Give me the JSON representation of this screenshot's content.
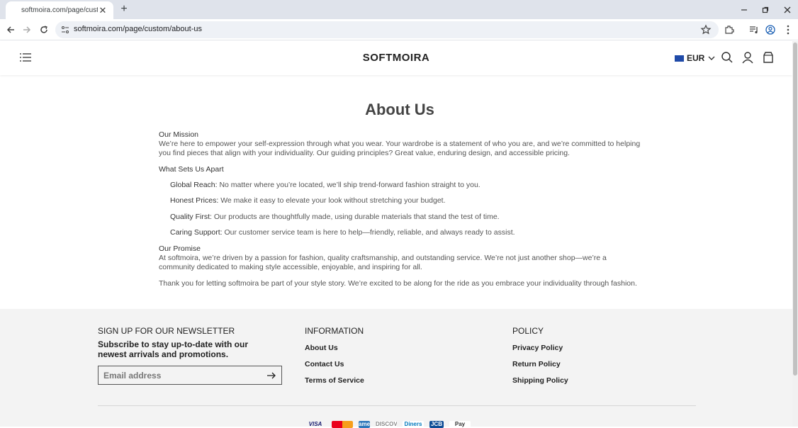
{
  "browser": {
    "tab_title": "softmoira.com/page/custom/about-us",
    "url": "softmoira.com/page/custom/about-us"
  },
  "site": {
    "logo": "SOFTMOIRA",
    "currency": "EUR"
  },
  "page": {
    "title": "About Us",
    "mission_heading": "Our Mission",
    "mission_text": "We’re here to empower your self-expression through what you wear. Your wardrobe is a statement of who you are, and we’re committed to helping you find pieces that align with your individuality. Our guiding principles? Great value, enduring design, and accessible pricing.",
    "apart_heading": "What Sets Us Apart",
    "items": [
      {
        "label": "Global Reach:",
        "text": " No matter where you’re located, we’ll ship trend-forward fashion straight to you."
      },
      {
        "label": "Honest Prices:",
        "text": " We make it easy to elevate your look without stretching your budget."
      },
      {
        "label": "Quality First:",
        "text": " Our products are thoughtfully made, using durable materials that stand the test of time."
      },
      {
        "label": "Caring Support:",
        "text": " Our customer service team is here to help—friendly, reliable, and always ready to assist."
      }
    ],
    "promise_heading": "Our Promise",
    "promise_text": "At softmoira, we’re driven by a passion for fashion, quality craftsmanship, and outstanding service. We’re not just another shop—we’re a community dedicated to making style accessible, enjoyable, and inspiring for all.",
    "thanks_text": "Thank you for letting softmoira be part of your style story. We’re excited to be along for the ride as you embrace your individuality through fashion."
  },
  "footer": {
    "newsletter_title": "SIGN UP FOR OUR NEWSLETTER",
    "newsletter_sub": "Subscribe to stay up-to-date with our newest arrivals and promotions.",
    "email_placeholder": "Email address",
    "info_title": "INFORMATION",
    "info_links": [
      "About Us",
      "Contact Us",
      "Terms of Service"
    ],
    "policy_title": "POLICY",
    "policy_links": [
      "Privacy Policy",
      "Return Policy",
      "Shipping Policy"
    ],
    "payments": [
      "VISA",
      "mastercard",
      "amex",
      "DISCOVER",
      "Diners",
      "JCB",
      "Pay"
    ]
  }
}
